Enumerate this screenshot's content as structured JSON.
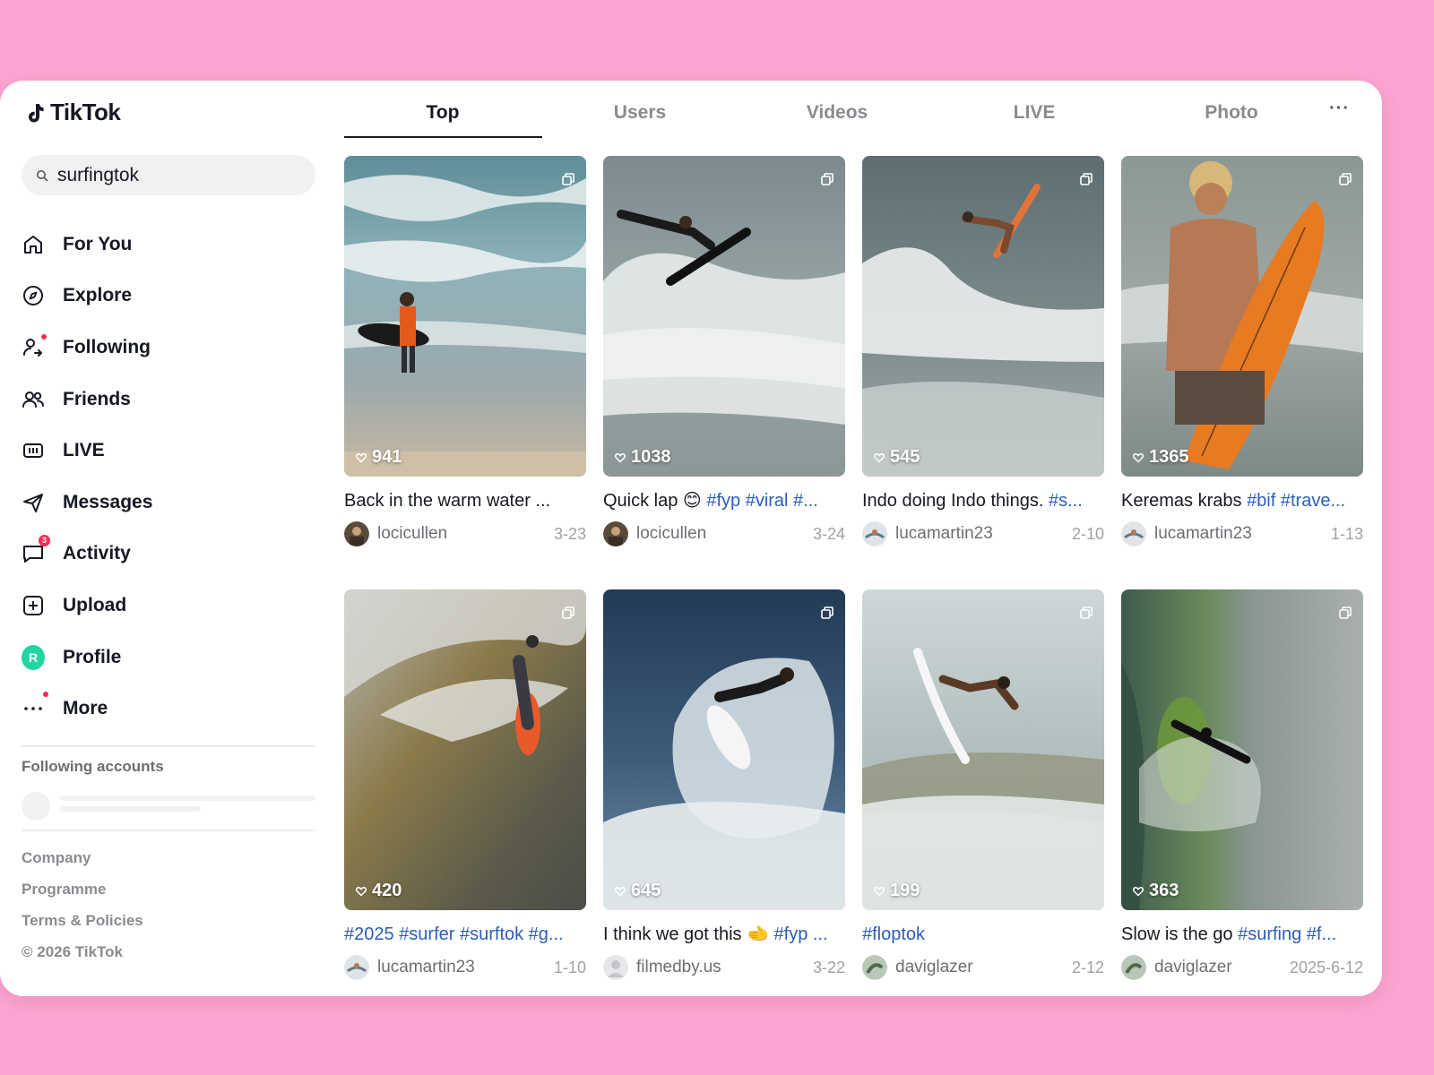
{
  "app": {
    "name": "TikTok"
  },
  "search": {
    "value": "surfingtok",
    "icon": "search-icon"
  },
  "nav": [
    {
      "label": "For You",
      "icon": "home-icon"
    },
    {
      "label": "Explore",
      "icon": "compass-icon"
    },
    {
      "label": "Following",
      "icon": "following-icon",
      "dot": true
    },
    {
      "label": "Friends",
      "icon": "friends-icon"
    },
    {
      "label": "LIVE",
      "icon": "live-icon"
    },
    {
      "label": "Messages",
      "icon": "send-icon"
    },
    {
      "label": "Activity",
      "icon": "chat-icon",
      "badge": "3"
    },
    {
      "label": "Upload",
      "icon": "plus-square-icon"
    },
    {
      "label": "Profile",
      "icon": "avatar",
      "avatar_letter": "R"
    },
    {
      "label": "More",
      "icon": "more-dots-icon",
      "dot": true
    }
  ],
  "following_accounts": {
    "title": "Following accounts"
  },
  "footer": [
    "Company",
    "Programme",
    "Terms & Policies",
    "© 2026 TikTok"
  ],
  "tabs": {
    "items": [
      "Top",
      "Users",
      "Videos",
      "LIVE",
      "Photo"
    ],
    "active": "Top",
    "more": "···"
  },
  "colors": {
    "accent": "#fe2c55",
    "hashtag": "#2b5db9",
    "background": "#fea4d2",
    "profile_avatar": "#20d5a2"
  },
  "videos": [
    {
      "likes": "941",
      "caption_text": "Back in the warm water ...",
      "caption_tags": "",
      "user": "locicullen",
      "date": "3-23"
    },
    {
      "likes": "1038",
      "caption_text": "Quick lap 😊 ",
      "caption_tags": "#fyp #viral #...",
      "user": "locicullen",
      "date": "3-24"
    },
    {
      "likes": "545",
      "caption_text": "Indo doing Indo things. ",
      "caption_tags": "#s...",
      "user": "lucamartin23",
      "date": "2-10"
    },
    {
      "likes": "1365",
      "caption_text": "Keremas krabs ",
      "caption_tags": "#bif #trave...",
      "user": "lucamartin23",
      "date": "1-13"
    },
    {
      "likes": "420",
      "caption_text": "",
      "caption_tags": "#2025 #surfer #surftok #g...",
      "user": "lucamartin23",
      "date": "1-10"
    },
    {
      "likes": "645",
      "caption_text": "I think we got this 🫲 ",
      "caption_tags": "#fyp ...",
      "user": "filmedby.us",
      "date": "3-22"
    },
    {
      "likes": "199",
      "caption_text": "",
      "caption_tags": "#floptok",
      "user": "daviglazer",
      "date": "2-12"
    },
    {
      "likes": "363",
      "caption_text": "Slow is the go ",
      "caption_tags": "#surfing #f...",
      "user": "daviglazer",
      "date": "2025-6-12"
    }
  ]
}
